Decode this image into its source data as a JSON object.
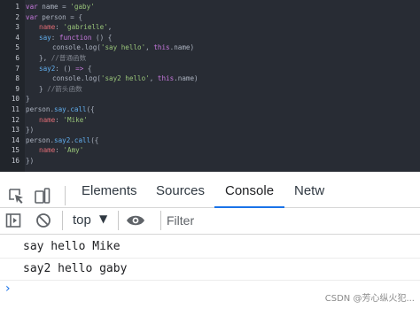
{
  "editor": {
    "lines": [
      {
        "num": "1",
        "tokens": [
          {
            "t": "var ",
            "c": "kw"
          },
          {
            "t": "name",
            "c": "pl"
          },
          {
            "t": " = ",
            "c": "pl"
          },
          {
            "t": "'gaby'",
            "c": "str"
          }
        ],
        "indent": 1
      },
      {
        "num": "2",
        "tokens": [
          {
            "t": "var ",
            "c": "kw"
          },
          {
            "t": "person",
            "c": "pl"
          },
          {
            "t": " = {",
            "c": "pl"
          }
        ],
        "indent": 1
      },
      {
        "num": "3",
        "tokens": [
          {
            "t": "name",
            "c": "prop"
          },
          {
            "t": ": ",
            "c": "pl"
          },
          {
            "t": "'gabrielle'",
            "c": "str"
          },
          {
            "t": ",",
            "c": "pl"
          }
        ],
        "indent": 2
      },
      {
        "num": "4",
        "tokens": [
          {
            "t": "say",
            "c": "fn"
          },
          {
            "t": ": ",
            "c": "pl"
          },
          {
            "t": "function",
            "c": "kw"
          },
          {
            "t": " () {",
            "c": "pl"
          }
        ],
        "indent": 2
      },
      {
        "num": "5",
        "tokens": [
          {
            "t": "console",
            "c": "pl"
          },
          {
            "t": ".log(",
            "c": "pl"
          },
          {
            "t": "'say hello'",
            "c": "str"
          },
          {
            "t": ", ",
            "c": "pl"
          },
          {
            "t": "this",
            "c": "kw"
          },
          {
            "t": ".name)",
            "c": "pl"
          }
        ],
        "indent": 3
      },
      {
        "num": "6",
        "tokens": [
          {
            "t": "}, ",
            "c": "pl"
          },
          {
            "t": "//普通函数",
            "c": "cmt"
          }
        ],
        "indent": 2
      },
      {
        "num": "7",
        "tokens": [
          {
            "t": "say2",
            "c": "fn"
          },
          {
            "t": ": () ",
            "c": "pl"
          },
          {
            "t": "=>",
            "c": "kw"
          },
          {
            "t": " {",
            "c": "pl"
          }
        ],
        "indent": 2
      },
      {
        "num": "8",
        "tokens": [
          {
            "t": "console",
            "c": "pl"
          },
          {
            "t": ".log(",
            "c": "pl"
          },
          {
            "t": "'say2 hello'",
            "c": "str"
          },
          {
            "t": ", ",
            "c": "pl"
          },
          {
            "t": "this",
            "c": "kw"
          },
          {
            "t": ".name)",
            "c": "pl"
          }
        ],
        "indent": 3
      },
      {
        "num": "9",
        "tokens": [
          {
            "t": "} ",
            "c": "pl"
          },
          {
            "t": "//箭头函数",
            "c": "cmt"
          }
        ],
        "indent": 2
      },
      {
        "num": "10",
        "tokens": [
          {
            "t": "}",
            "c": "pl"
          }
        ],
        "indent": 1
      },
      {
        "num": "11",
        "tokens": [
          {
            "t": "person",
            "c": "pl"
          },
          {
            "t": ".",
            "c": "pl"
          },
          {
            "t": "say",
            "c": "fn"
          },
          {
            "t": ".",
            "c": "pl"
          },
          {
            "t": "call",
            "c": "fn"
          },
          {
            "t": "({",
            "c": "pl"
          }
        ],
        "indent": 1
      },
      {
        "num": "12",
        "tokens": [
          {
            "t": "name",
            "c": "prop"
          },
          {
            "t": ": ",
            "c": "pl"
          },
          {
            "t": "'Mike'",
            "c": "str"
          }
        ],
        "indent": 2
      },
      {
        "num": "13",
        "tokens": [
          {
            "t": "})",
            "c": "pl"
          }
        ],
        "indent": 1
      },
      {
        "num": "14",
        "tokens": [
          {
            "t": "person",
            "c": "pl"
          },
          {
            "t": ".",
            "c": "pl"
          },
          {
            "t": "say2",
            "c": "fn"
          },
          {
            "t": ".",
            "c": "pl"
          },
          {
            "t": "call",
            "c": "fn"
          },
          {
            "t": "({",
            "c": "pl"
          }
        ],
        "indent": 1
      },
      {
        "num": "15",
        "tokens": [
          {
            "t": "name",
            "c": "prop"
          },
          {
            "t": ": ",
            "c": "pl"
          },
          {
            "t": "'Amy'",
            "c": "str"
          }
        ],
        "indent": 2
      },
      {
        "num": "16",
        "tokens": [
          {
            "t": "})",
            "c": "pl"
          }
        ],
        "indent": 1
      }
    ]
  },
  "devtools": {
    "tabs": [
      {
        "label": "Elements",
        "active": false
      },
      {
        "label": "Sources",
        "active": false
      },
      {
        "label": "Console",
        "active": true
      },
      {
        "label": "Netw",
        "active": false
      }
    ],
    "context": "top",
    "filter_placeholder": "Filter",
    "logs": [
      "say hello Mike",
      "say2 hello gaby"
    ],
    "prompt": "›",
    "accent": "#1a73e8"
  },
  "watermark": "CSDN @芳心纵火犯..."
}
